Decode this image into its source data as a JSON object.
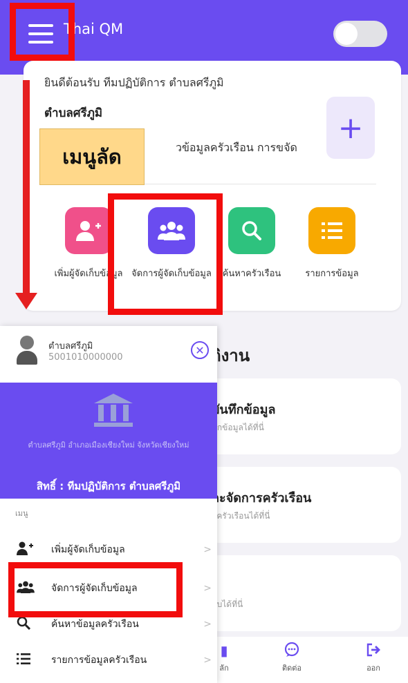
{
  "app": {
    "title": "Thai QM"
  },
  "welcome": {
    "text": "ยินดีต้อนรับ ทีมปฏิบัติการ ตำบลศรีภูมิ",
    "subdistrict": "ตำบลศรีภูมิ",
    "description": "วข้อมูลครัวเรือน การขจัด",
    "add_symbol": "+"
  },
  "callout": {
    "label": "เมนูลัด"
  },
  "quick_actions": [
    {
      "label": "เพิ่มผู้จัดเก็บข้อมูล",
      "icon": "add-user-icon",
      "color": "#f0508a"
    },
    {
      "label": "จัดการผู้จัดเก็บข้อมูล",
      "icon": "users-icon",
      "color": "#6a4cf0"
    },
    {
      "label": "ค้นหาครัวเรือน",
      "icon": "search-icon",
      "color": "#2ec27e"
    },
    {
      "label": "รายการข้อมูล",
      "icon": "list-icon",
      "color": "#f8a900"
    }
  ],
  "section": {
    "title": "ติงาน"
  },
  "task_cards": [
    {
      "title": "บันทึกข้อมูล",
      "subtitle": "ทึกข้อมูลได้ที่นี่"
    },
    {
      "title": "ละจัดการครัวเรือน",
      "subtitle": "ุลครัวเรือนได้ที่นี่"
    },
    {
      "title": "",
      "subtitle": "บบได้ที่นี่"
    }
  ],
  "bottom_nav": [
    {
      "label": "ลัก",
      "icon": "home-icon"
    },
    {
      "label": "ติดต่อ",
      "icon": "chat-icon"
    },
    {
      "label": "ออก",
      "icon": "logout-icon"
    }
  ],
  "drawer": {
    "user_name": "ตำบลศรีภูมิ",
    "user_id": "5001010000000",
    "address": "ตำบลศรีภูมิ อำเภอเมืองเชียงใหม่ จังหวัดเชียงใหม่",
    "role": "สิทธิ์ : ทีมปฏิบัติการ ตำบลศรีภูมิ",
    "menu_heading": "เมนู",
    "items": [
      {
        "label": "เพิ่มผู้จัดเก็บข้อมูล",
        "icon": "add-user-icon"
      },
      {
        "label": "จัดการผู้จัดเก็บข้อมูล",
        "icon": "users-icon"
      },
      {
        "label": "ค้นหาข้อมูลครัวเรือน",
        "icon": "search-icon"
      },
      {
        "label": "รายการข้อมูลครัวเรือน",
        "icon": "list-icon"
      }
    ]
  },
  "colors": {
    "primary": "#6a4cf0",
    "highlight": "#f20d0d",
    "callout": "#ffd88a"
  }
}
